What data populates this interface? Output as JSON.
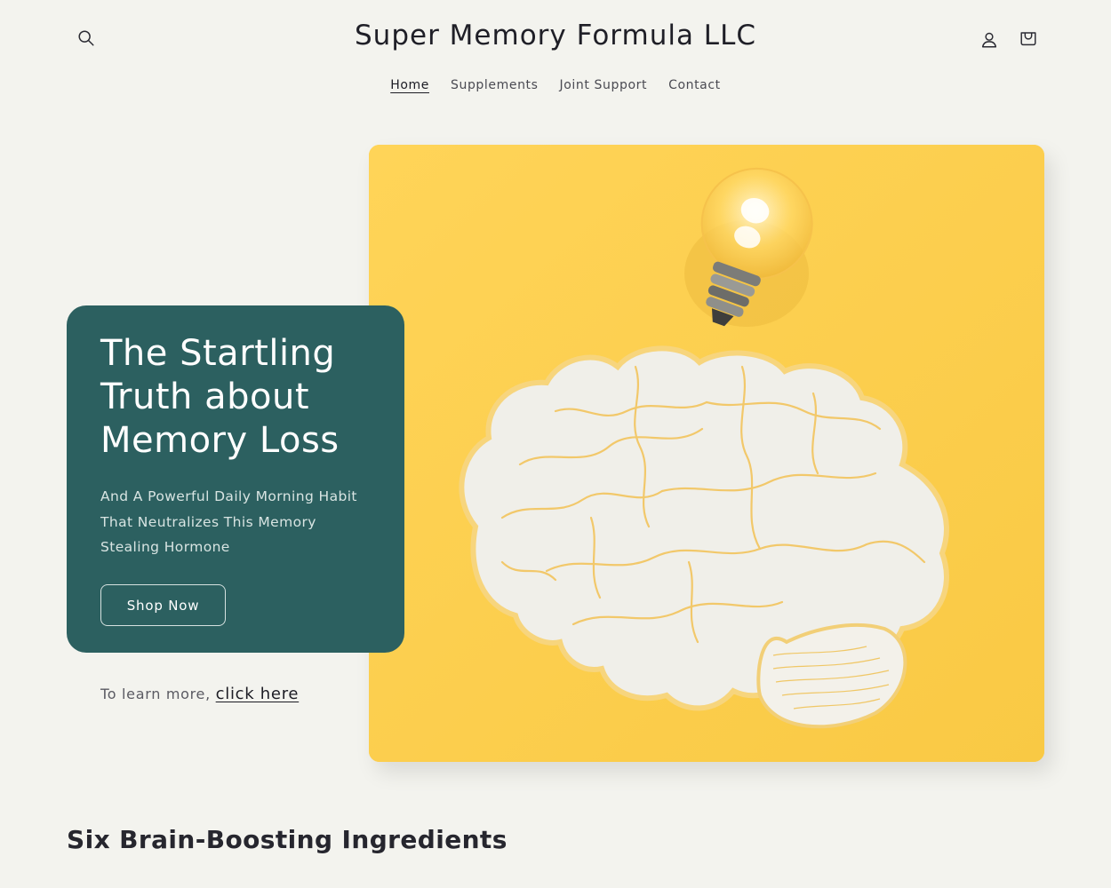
{
  "header": {
    "store_title": "Super Memory Formula LLC",
    "icons": [
      "search-icon",
      "account-icon",
      "cart-icon"
    ]
  },
  "nav": {
    "items": [
      {
        "label": "Home",
        "active": true
      },
      {
        "label": "Supplements",
        "active": false
      },
      {
        "label": "Joint Support",
        "active": false
      },
      {
        "label": "Contact",
        "active": false
      }
    ]
  },
  "hero": {
    "title_lines": [
      "The Startling",
      "Truth about",
      "Memory Loss"
    ],
    "subtitle_lines": [
      "And A Powerful Daily Morning Habit",
      "That Neutralizes This Memory",
      "Stealing Hormone"
    ],
    "button_label": "Shop Now",
    "learn_more_prefix": "To learn more, ",
    "learn_more_link": "click here",
    "image": "lightbulb-and-brain-illustration"
  },
  "section": {
    "title": "Six Brain-Boosting Ingredients"
  },
  "colors": {
    "background": "#f3f3ee",
    "card": "#2c6060",
    "image_bg": "#fbcd4f",
    "text": "#1c1c24"
  }
}
